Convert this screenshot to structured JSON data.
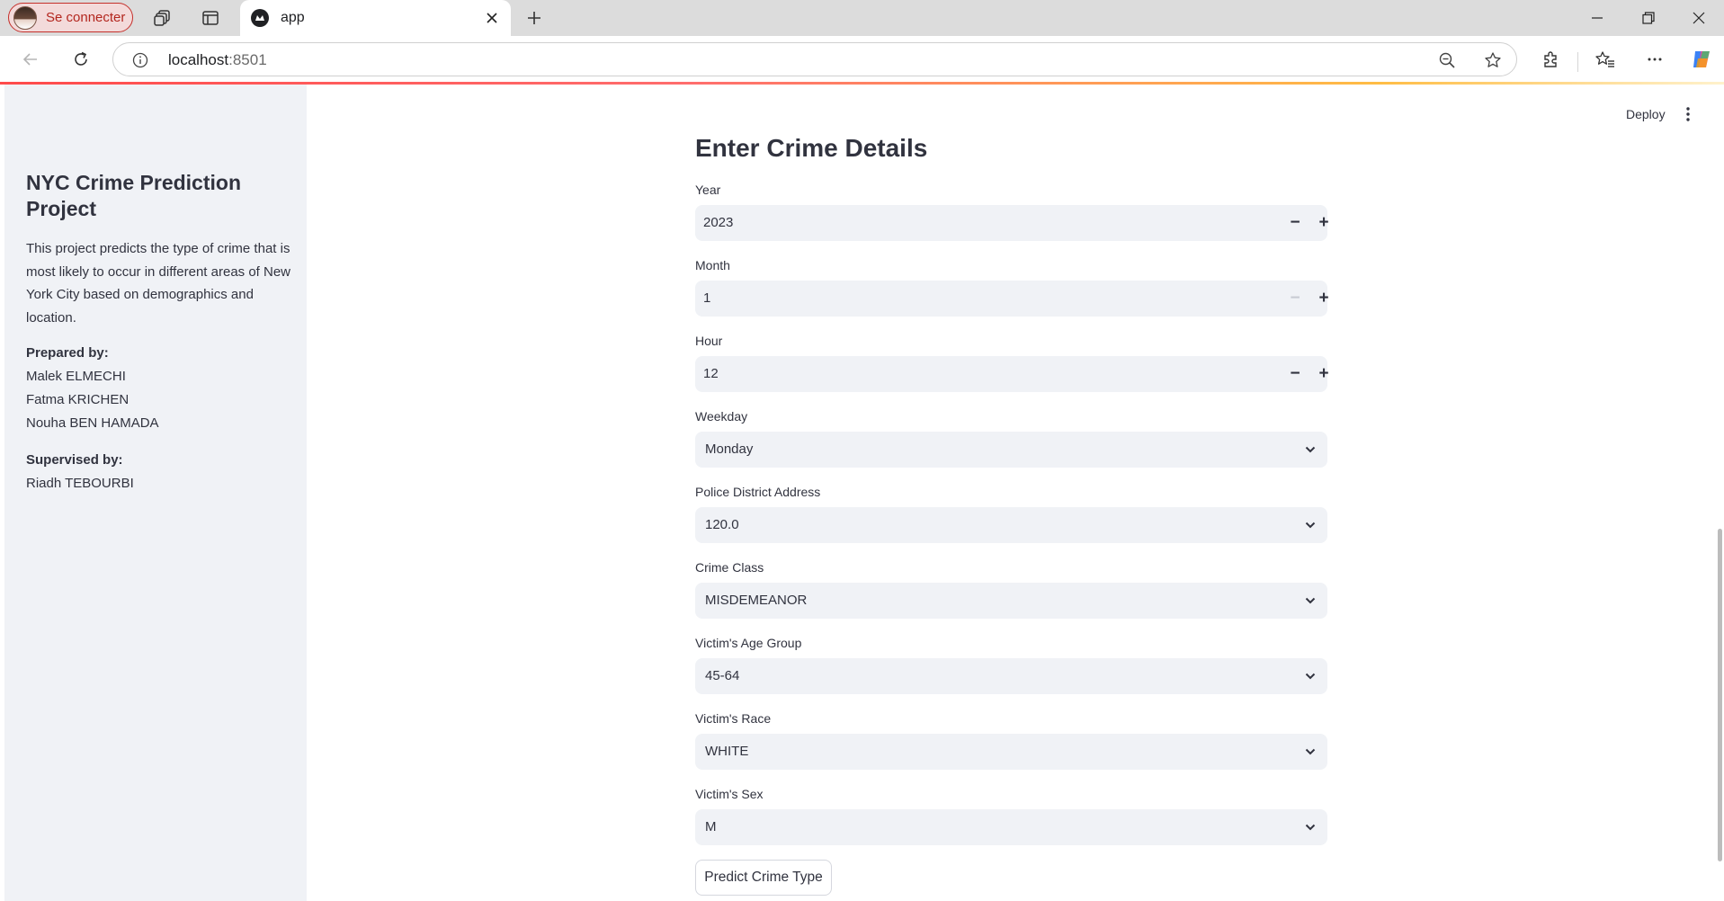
{
  "browser": {
    "profile_label": "Se connecter",
    "tab_title": "app",
    "url_host": "localhost",
    "url_port": ":8501"
  },
  "app": {
    "deploy_label": "Deploy"
  },
  "sidebar": {
    "title": "NYC Crime Prediction Project",
    "description": "This project predicts the type of crime that is most likely to occur in different areas of New York City based on demographics and location.",
    "prepared_by_label": "Prepared by:",
    "prepared_by": [
      "Malek ELMECHI",
      "Fatma KRICHEN",
      "Nouha BEN HAMADA"
    ],
    "supervised_by_label": "Supervised by:",
    "supervised_by": "Riadh TEBOURBI"
  },
  "form": {
    "title": "Enter Crime Details",
    "fields": [
      {
        "label": "Year",
        "value": "2023"
      },
      {
        "label": "Month",
        "value": "1"
      },
      {
        "label": "Hour",
        "value": "12"
      },
      {
        "label": "Weekday",
        "value": "Monday"
      },
      {
        "label": "Police District Address",
        "value": "120.0"
      },
      {
        "label": "Crime Class",
        "value": "MISDEMEANOR"
      },
      {
        "label": "Victim's Age Group",
        "value": "45-64"
      },
      {
        "label": "Victim's Race",
        "value": "WHITE"
      },
      {
        "label": "Victim's Sex",
        "value": "M"
      }
    ],
    "submit_label": "Predict Crime Type"
  },
  "icons": {
    "stepper_minus": "−",
    "stepper_plus": "+"
  },
  "colors": {
    "accent": "#ff4b4b",
    "sidebar_bg": "#f0f2f6",
    "input_bg": "#f0f2f6",
    "text": "#31333f"
  }
}
